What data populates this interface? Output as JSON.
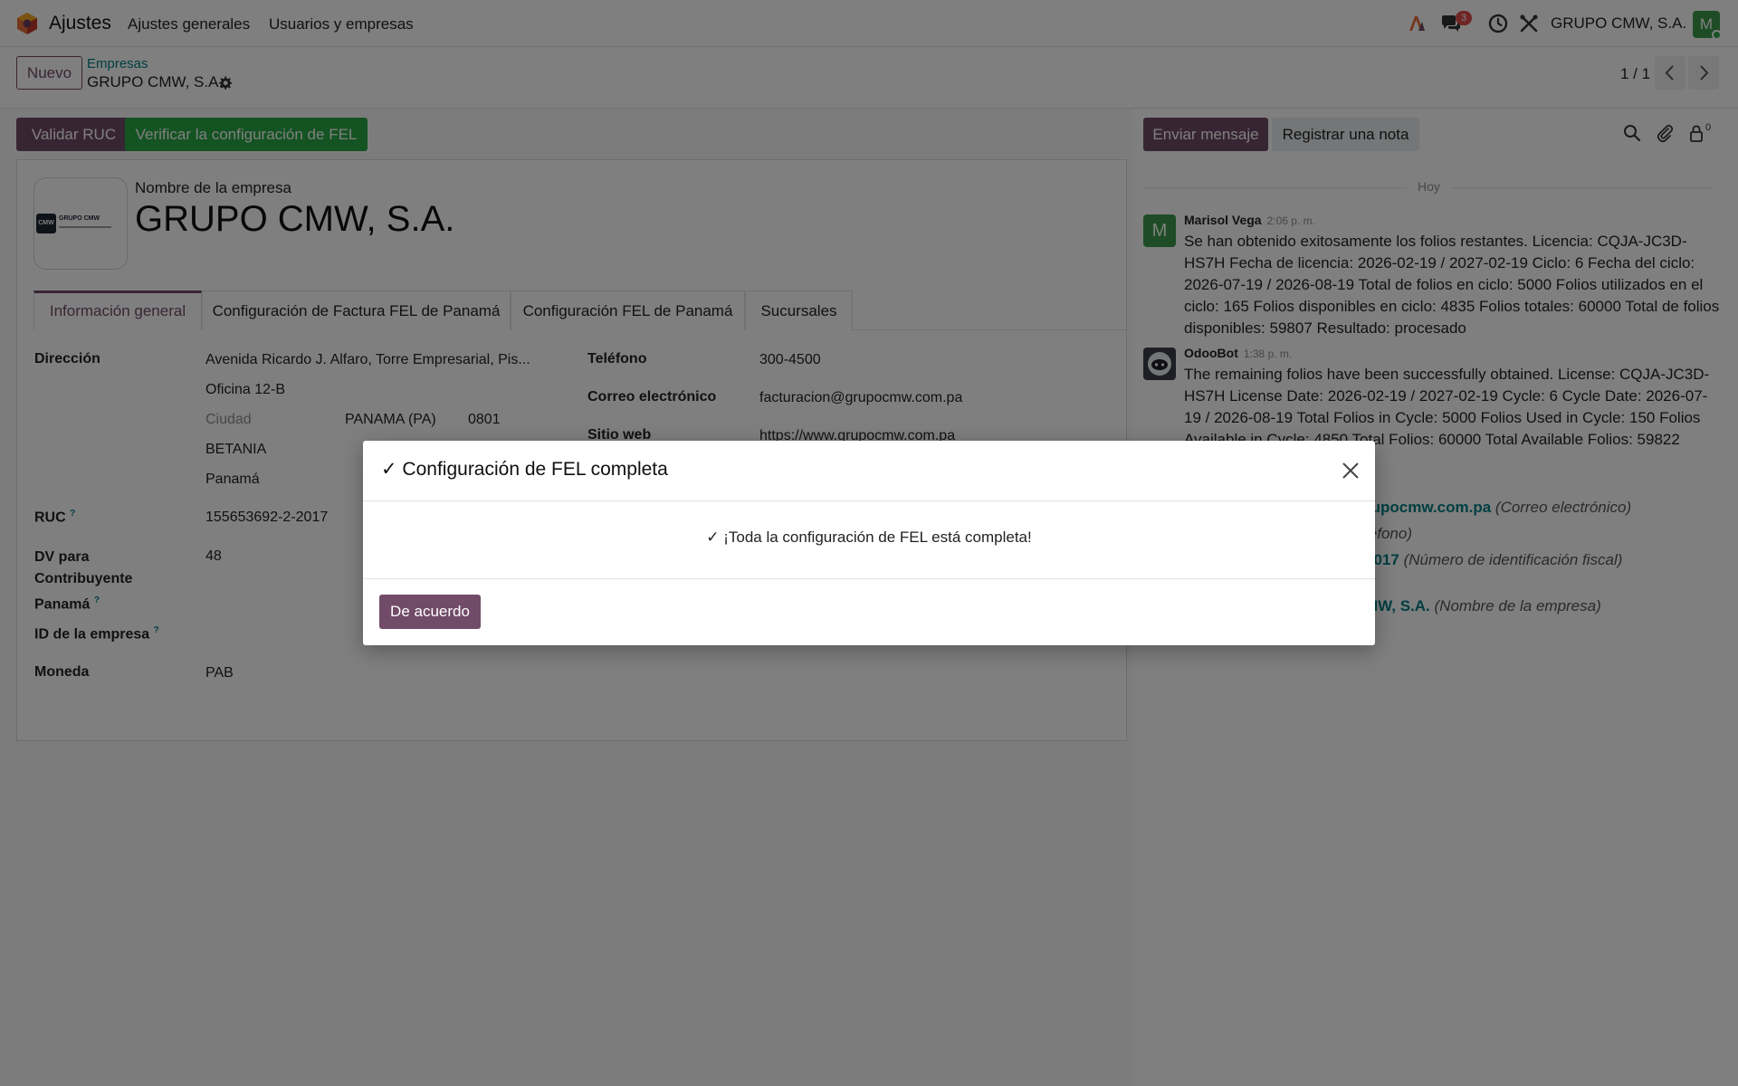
{
  "topbar": {
    "app_name": "Ajustes",
    "menu": [
      "Ajustes generales",
      "Usuarios y empresas"
    ],
    "chat_badge": "3",
    "company": "GRUPO CMW, S.A.",
    "avatar_letter": "M"
  },
  "control": {
    "new_button": "Nuevo",
    "breadcrumb_parent": "Empresas",
    "breadcrumb_current": "GRUPO CMW, S.A.",
    "pager": "1 / 1"
  },
  "actions": {
    "validate_ruc": "Validar RUC",
    "verify_fel": "Verificar la configuración de FEL",
    "send_message": "Enviar mensaje",
    "log_note": "Registrar una nota",
    "followers_count": "0"
  },
  "form": {
    "logo_text": "GRUPO CMW",
    "logo_abbr": "CMW",
    "name_label": "Nombre de la empresa",
    "name_value": "GRUPO CMW, S.A.",
    "tabs": [
      "Información general",
      "Configuración de Factura FEL de Panamá",
      "Configuración FEL de Panamá",
      "Sucursales"
    ],
    "address_label": "Dirección",
    "street": "Avenida Ricardo J. Alfaro, Torre Empresarial, Pis...",
    "street2": "Oficina 12-B",
    "city_placeholder": "Ciudad",
    "state": "PANAMA (PA)",
    "zip": "0801",
    "district": "BETANIA",
    "country": "Panamá",
    "ruc_label": "RUC",
    "ruc_value": "155653692-2-2017",
    "dv_label": "DV para Contribuyente Panamá",
    "dv_value": "48",
    "company_id_label": "ID de la empresa",
    "currency_label": "Moneda",
    "currency_value": "PAB",
    "phone_label": "Teléfono",
    "phone_value": "300-4500",
    "email_label": "Correo electrónico",
    "email_value": "facturacion@grupocmw.com.pa",
    "website_label": "Sitio web",
    "website_value": "https://www.grupocmw.com.pa"
  },
  "chatter": {
    "today": "Hoy",
    "messages": [
      {
        "author": "Marisol Vega",
        "time": "2:06 p. m.",
        "avatar_letter": "M",
        "body": "Se han obtenido exitosamente los folios restantes. Licencia: CQJA-JC3D-HS7H Fecha de licencia: 2026-02-19 / 2027-02-19 Ciclo: 6 Fecha del ciclo: 2026-07-19 / 2026-08-19 Total de folios en ciclo: 5000 Folios utilizados en el ciclo: 165 Folios disponibles en ciclo: 4835 Folios totales: 60000 Total de folios disponibles: 59807 Resultado: procesado"
      },
      {
        "author": "OdooBot",
        "time": "1:38 p. m.",
        "body": "The remaining folios have been successfully obtained. License: CQJA-JC3D-HS7H License Date: 2026-02-19 / 2027-02-19 Cycle: 6 Cycle Date: 2026-07-19 / 2026-08-19 Total Folios in Cycle: 5000 Folios Used in Cycle: 150 Folios Available in Cycle: 4850 Total Folios: 60000 Total Available Folios: 59822 Result:"
      }
    ],
    "tracking": [
      {
        "value": "rupocmw.com.pa",
        "field": "(Correo electrónico)"
      },
      {
        "value": "",
        "field": "léfono)"
      },
      {
        "value": "2017",
        "field": "(Número de identificación fiscal)"
      },
      {
        "value": "MW, S.A.",
        "field": "(Nombre de la empresa)"
      }
    ]
  },
  "dialog": {
    "title": "✓ Configuración de FEL completa",
    "message": "✓ ¡Toda la configuración de FEL está completa!",
    "ok_button": "De acuerdo"
  },
  "colors": {
    "primary": "#714b67",
    "success": "#28a745",
    "link": "#017e84"
  }
}
